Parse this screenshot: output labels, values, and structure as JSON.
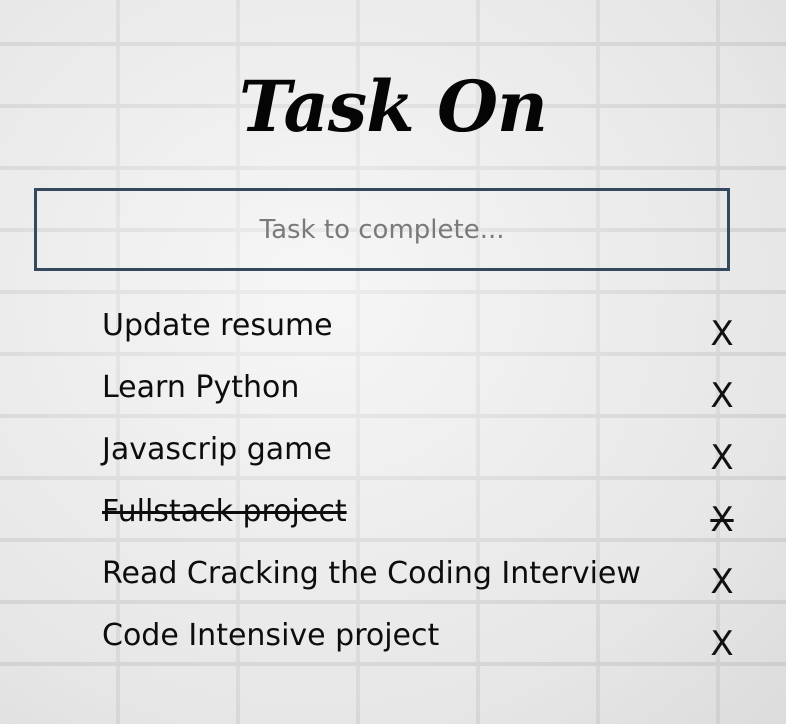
{
  "app": {
    "title": "Task On"
  },
  "input": {
    "placeholder": "Task to complete...",
    "value": ""
  },
  "tasks": [
    {
      "label": "Update resume",
      "completed": false,
      "delete_label": "X"
    },
    {
      "label": "Learn Python",
      "completed": false,
      "delete_label": "X"
    },
    {
      "label": "Javascrip game",
      "completed": false,
      "delete_label": "X"
    },
    {
      "label": "Fullstack project",
      "completed": true,
      "delete_label": "X"
    },
    {
      "label": "Read Cracking the Coding Interview",
      "completed": false,
      "delete_label": "X"
    },
    {
      "label": "Code Intensive project",
      "completed": false,
      "delete_label": "X"
    }
  ],
  "colors": {
    "input_border": "#34495e",
    "text": "#111111"
  }
}
